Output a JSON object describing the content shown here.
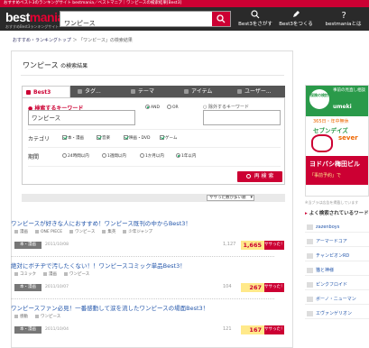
{
  "top_strip": "おすすめベスト3のランキングサイト bestmania／ベストマニア｜ワンピースの検索結果[Best3]",
  "header": {
    "logo_main": "best",
    "logo_accent": "mania",
    "logo_sub": "おすすめBest3ランキングサイト",
    "search_value": "ワンピース",
    "nav": [
      {
        "label": "Best3をさがす",
        "icon": "search-icon"
      },
      {
        "label": "Best3をつくる",
        "icon": "pencil-icon"
      },
      {
        "label": "bestmaniaとは",
        "icon": "question-icon"
      }
    ]
  },
  "breadcrumb": {
    "home": "おすすめ・ランキングトップ",
    "sep": "＞",
    "current": "「ワンピース」の検索結果"
  },
  "page_title": {
    "main": "ワンピース",
    "suffix": "の検索結果"
  },
  "tabs": [
    {
      "label": "Best3",
      "active": true
    },
    {
      "label": "タグ..."
    },
    {
      "label": "テーマ"
    },
    {
      "label": "アイテム"
    },
    {
      "label": "ユーザー..."
    }
  ],
  "form": {
    "keyword_label": "検索するキーワード",
    "keyword_value": "ワンピース",
    "and_label": "AND",
    "or_label": "OR",
    "exclude_label": "除外するキーワード",
    "category_label": "カテゴリ",
    "categories": [
      "本・漫画",
      "音楽",
      "映画・DVD",
      "ゲーム"
    ],
    "period_label": "期間",
    "periods": [
      "24時間以内",
      "1週間以内",
      "1か月以内",
      "1年以内"
    ],
    "submit_label": "再 検 索"
  },
  "sort": {
    "selected": "ササった数が多い順"
  },
  "results": [
    {
      "title": "ワンピースが好きな人におすすめ！ワンピース既刊の中からBest3！",
      "tags": [
        "漫画",
        "ONE PIECE",
        "ワンピース",
        "集英",
        "少年ジャンプ"
      ],
      "category": "本・漫画",
      "date": "2011/10/08",
      "count": "1,127",
      "score": "1,665",
      "badge": "ササった！"
    },
    {
      "title": "絶対にボチヂで汚したくない！！ワンピースコミック単品Best3！",
      "tags": [
        "コミック",
        "漫画",
        "ワンピース"
      ],
      "category": "本・漫画",
      "date": "2011/10/07",
      "count": "104",
      "score": "267",
      "badge": "ササった！"
    },
    {
      "title": "ワンピースファン必見！一番感動して涙を流したワンピースの場面Best3！",
      "tags": [
        "感動",
        "ワンピース"
      ],
      "category": "本・漫画",
      "date": "2011/10/04",
      "count": "121",
      "score": "167",
      "badge": "ササった！"
    }
  ],
  "ad": {
    "badge": "保険の検討",
    "header": "事前の見直し相談",
    "logo": "umeki",
    "tagline": "365日・年中無休",
    "brand_seven": "セブンデイズ",
    "brand": "sever",
    "store": "ヨドバシ梅田ビル",
    "promo": "「事前予約」で",
    "note": "※当ブラは広告を掲載しています"
  },
  "sidebar": {
    "heading": "よく検索されているワード",
    "items": [
      "zazenboys",
      "アーマードコア",
      "チャンピオンRD",
      "猫と神様",
      "ピンクフロイド",
      "ボーノ・ニューマン",
      "エヴァンゲリオン"
    ]
  }
}
